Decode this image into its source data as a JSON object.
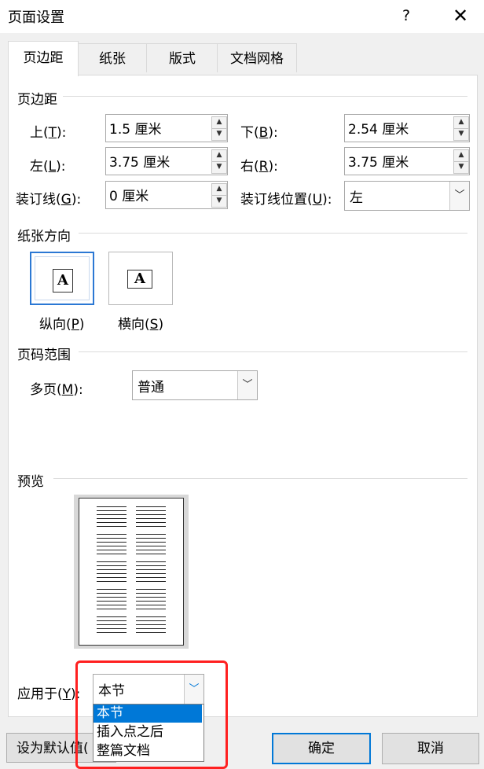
{
  "window": {
    "title": "页面设置",
    "help": "?",
    "close": "✕"
  },
  "tabs": [
    {
      "label": "页边距"
    },
    {
      "label": "纸张"
    },
    {
      "label": "版式"
    },
    {
      "label": "文档网格"
    }
  ],
  "margins": {
    "section": "页边距",
    "top": {
      "label": "上(",
      "key": "T",
      "suffix": "):",
      "value": "1.5 厘米"
    },
    "bottom": {
      "label": "下(",
      "key": "B",
      "suffix": "):",
      "value": "2.54 厘米"
    },
    "left": {
      "label": "左(",
      "key": "L",
      "suffix": "):",
      "value": "3.75 厘米"
    },
    "right": {
      "label": "右(",
      "key": "R",
      "suffix": "):",
      "value": "3.75 厘米"
    },
    "gutter": {
      "label": "装订线(",
      "key": "G",
      "suffix": "):",
      "value": "0 厘米"
    },
    "gutter_pos": {
      "label": "装订线位置(",
      "key": "U",
      "suffix": "):",
      "value": "左"
    }
  },
  "orientation": {
    "section": "纸张方向",
    "icon_letter": "A",
    "portrait": {
      "label": "纵向(",
      "key": "P",
      "suffix": ")"
    },
    "landscape": {
      "label": "横向(",
      "key": "S",
      "suffix": ")"
    }
  },
  "pages": {
    "section": "页码范围",
    "multiple": {
      "label": "多页(",
      "key": "M",
      "suffix": "):",
      "value": "普通"
    }
  },
  "preview": {
    "section": "预览"
  },
  "apply": {
    "label": "应用于(",
    "key": "Y",
    "suffix": "):",
    "value": "本节",
    "options": [
      "本节",
      "插入点之后",
      "整篇文档"
    ]
  },
  "buttons": {
    "default": "设为默认值(",
    "ok": "确定",
    "cancel": "取消"
  },
  "colors": {
    "accent": "#0078d7",
    "highlight": "#ff2020"
  }
}
